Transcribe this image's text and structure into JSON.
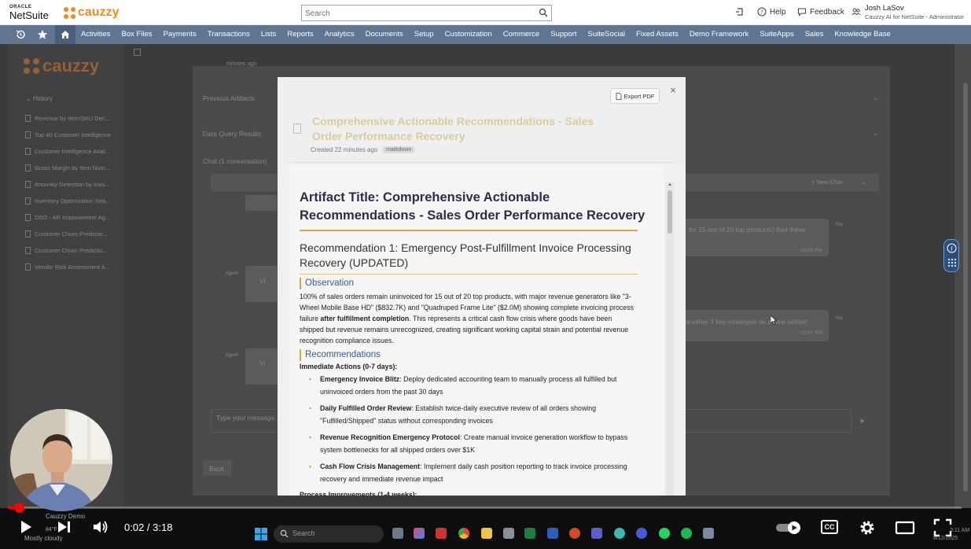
{
  "topbar": {
    "oracle_text": "ORACLE",
    "netsuite_text": "NetSuite",
    "brand_name": "cauzzy",
    "search_placeholder": "Search",
    "help_label": "Help",
    "feedback_label": "Feedback",
    "user_name": "Josh LaSov",
    "user_role": "Cauzzy AI for NetSuite - Administrator"
  },
  "nav": {
    "items": [
      "Activities",
      "Box Files",
      "Payments",
      "Transactions",
      "Lists",
      "Reports",
      "Analytics",
      "Documents",
      "Setup",
      "Customization",
      "Commerce",
      "Support",
      "SuiteSocial",
      "Fixed Assets",
      "Demo Framework",
      "SuiteApps",
      "Sales",
      "Knowledge Base"
    ]
  },
  "sidebar": {
    "brand_name": "cauzzy",
    "history_title": "History",
    "history_items": [
      "Revenue by Item/SKU Dec...",
      "Top 40 Customer Intelligence",
      "Customer Intelligence Anal...",
      "Gross Margin by Item Num...",
      "Anomaly Detection by Invo...",
      "Inventory Optimization Sea...",
      "DSO - AR Improvement Ag...",
      "Customer Churn Predictio...",
      "Customer Churn Predictio...",
      "Vendor Risk Assessment A..."
    ]
  },
  "background": {
    "created_ago": "minutes ago",
    "previous_artifacts": "Previous Artifacts",
    "data_query_results": "Data Query Results",
    "chat_header": "Chat (1 conversation)",
    "new_chat": "+ New Chat",
    "agent_label_1": "Agent",
    "agent_label_2": "Agent",
    "bubble_vi_1": "Vi",
    "bubble_vi_2": "Vi",
    "msg_1": "for 15 out of 20 top products) that these",
    "msg_1_time": "03:03 PM",
    "msg_2": "another 3 key strategies as a new artifact",
    "msg_2_time": "03:07 PM",
    "you_1": "You",
    "you_2": "You",
    "input_placeholder": "Type your message...",
    "back_button": "Back"
  },
  "modal": {
    "export_label": "Export PDF",
    "close_label": "×",
    "title": "Comprehensive Actionable Recommendations - Sales Order Performance Recovery",
    "created": "Created 22 minutes ago",
    "badge": "markdown",
    "doc": {
      "h1": "Artifact Title: Comprehensive Actionable Recommendations - Sales Order Performance Recovery",
      "h2": "Recommendation 1: Emergency Post-Fulfillment Invoice Processing Recovery (UPDATED)",
      "observation_heading": "Observation",
      "observation_pre": "100% of sales orders remain uninvoiced for 15 out of 20 top products, with major revenue generators like \"3-Wheel Mobile Base HD\" ($832.7K) and \"Quadruped Frame Lite\" ($2.0M) showing complete invoicing process failure ",
      "observation_bold": "after fulfillment completion",
      "observation_post": ". This represents a critical cash flow crisis where goods have been shipped but revenue remains unrecognized, creating significant working capital strain and potential revenue recognition compliance issues.",
      "recommendations_heading": "Recommendations",
      "immediate_label": "Immediate Actions (0-7 days):",
      "actions": [
        {
          "title": "Emergency Invoice Blitz",
          "text": ": Deploy dedicated accounting team to manually process all fulfilled but uninvoiced orders from the past 30 days"
        },
        {
          "title": "Daily Fulfilled Order Review",
          "text": ": Establish twice-daily executive review of all orders showing \"Fulfilled/Shipped\" status without corresponding invoices"
        },
        {
          "title": "Revenue Recognition Emergency Protocol",
          "text": ": Create manual invoice generation workflow to bypass system bottlenecks for all shipped orders over $1K"
        },
        {
          "title": "Cash Flow Crisis Management",
          "text": ": Implement daily cash position reporting to track invoice processing recovery and immediate revenue impact"
        }
      ],
      "process_label": "Process Improvements (1-4 weeks):"
    }
  },
  "video": {
    "time": "0:02 / 3:18",
    "progress_fraction": 0.011,
    "presenter": "Cauzzy Demo",
    "weather_temp": "84°F",
    "weather_desc": "Mostly cloudy",
    "taskbar_search": "Search",
    "clock_time": "3:11 AM",
    "clock_date": "8/12/2025",
    "cc_label": "CC",
    "accent": "#ff0000"
  },
  "colors": {
    "nav_bg": "#5f7590",
    "brand_orange": "#f28b1e",
    "heading_dark": "#2b2f45",
    "gold_rule": "#d3a84b",
    "subheading_blue": "#3a5b8c"
  }
}
